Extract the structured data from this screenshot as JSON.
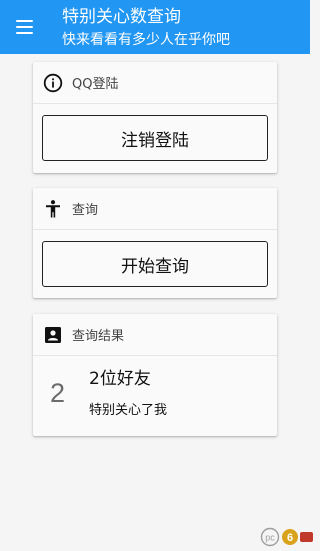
{
  "appbar": {
    "title": "特别关心数查询",
    "subtitle": "快来看看有多少人在乎你吧",
    "menu_icon": "menu-icon",
    "background": "#2196f3"
  },
  "cards": {
    "login": {
      "header_icon": "info-icon",
      "header_title": "QQ登陆",
      "button_label": "注销登陆"
    },
    "query": {
      "header_icon": "person-icon",
      "header_title": "查询",
      "button_label": "开始查询"
    },
    "result": {
      "header_icon": "contact-card-icon",
      "header_title": "查询结果",
      "count": "2",
      "friends_text": "2位好友",
      "note_text": "特别关心了我"
    }
  },
  "watermark": {
    "icon": "pc6-logo-icon"
  }
}
